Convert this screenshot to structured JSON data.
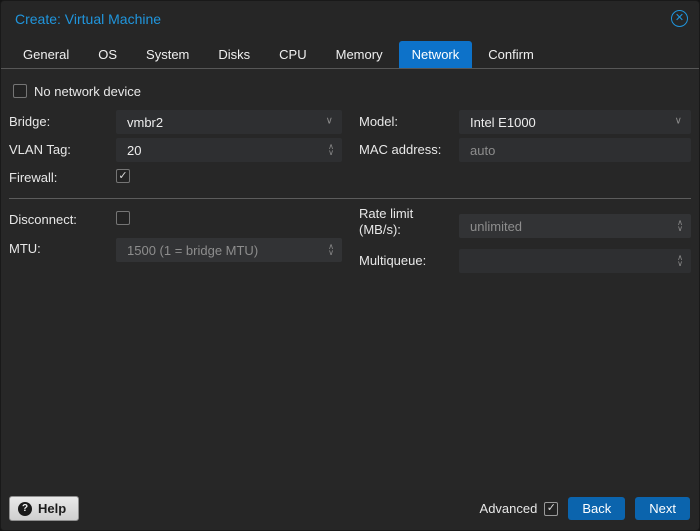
{
  "window": {
    "title": "Create: Virtual Machine"
  },
  "tabs": [
    {
      "label": "General",
      "active": false
    },
    {
      "label": "OS",
      "active": false
    },
    {
      "label": "System",
      "active": false
    },
    {
      "label": "Disks",
      "active": false
    },
    {
      "label": "CPU",
      "active": false
    },
    {
      "label": "Memory",
      "active": false
    },
    {
      "label": "Network",
      "active": true
    },
    {
      "label": "Confirm",
      "active": false
    }
  ],
  "form": {
    "no_network_device": {
      "label": "No network device",
      "checked": false
    },
    "bridge": {
      "label": "Bridge:",
      "value": "vmbr2",
      "type": "combo"
    },
    "model": {
      "label": "Model:",
      "value": "Intel E1000",
      "type": "combo"
    },
    "vlan_tag": {
      "label": "VLAN Tag:",
      "value": "20",
      "type": "number"
    },
    "mac_address": {
      "label": "MAC address:",
      "value": "",
      "placeholder": "auto"
    },
    "firewall": {
      "label": "Firewall:",
      "checked": true
    },
    "disconnect": {
      "label": "Disconnect:",
      "checked": false
    },
    "mtu": {
      "label": "MTU:",
      "value": "",
      "placeholder": "1500 (1 = bridge MTU)",
      "disabled": true
    },
    "rate_limit": {
      "label": "Rate limit (MB/s):",
      "value": "",
      "placeholder": "unlimited",
      "disabled": true
    },
    "multiqueue": {
      "label": "Multiqueue:",
      "value": "",
      "placeholder": "",
      "disabled": false
    }
  },
  "footer": {
    "help_label": "Help",
    "help_icon_glyph": "?",
    "advanced": {
      "label": "Advanced",
      "checked": true
    },
    "back_label": "Back",
    "next_label": "Next"
  },
  "icons": {
    "close_glyph": "✕",
    "combo_chevron": "∨",
    "spin_up": "∧",
    "spin_down": "∨",
    "check_glyph": "✓"
  },
  "colors": {
    "title_blue": "#2095dc",
    "active_tab_blue": "#0d72c9",
    "button_blue": "#0b64ad",
    "panel_bg": "#272727",
    "field_bg": "#2e2f31"
  }
}
